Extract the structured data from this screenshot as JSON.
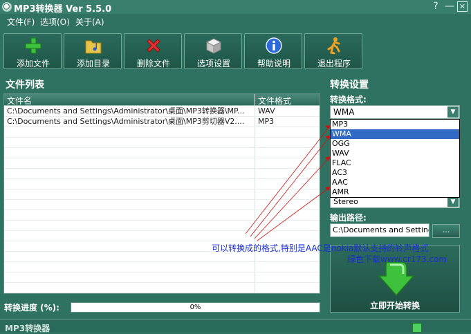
{
  "window": {
    "title": "MP3转换器 Ver 5.5.0",
    "help_glyph": "?",
    "minimize_glyph": "—",
    "close_glyph": "✕"
  },
  "menu": [
    "文件(F)",
    "选项(O)",
    "关于(A)"
  ],
  "toolbar": [
    {
      "label": "添加文件",
      "icon": "add-plus-icon"
    },
    {
      "label": "添加目录",
      "icon": "folder-music-icon"
    },
    {
      "label": "删除文件",
      "icon": "delete-x-icon"
    },
    {
      "label": "选项设置",
      "icon": "options-cube-icon"
    },
    {
      "label": "帮助说明",
      "icon": "info-icon"
    },
    {
      "label": "退出程序",
      "icon": "exit-runner-icon"
    }
  ],
  "file_list": {
    "title": "文件列表",
    "columns": [
      "文件名",
      "文件格式"
    ],
    "rows": [
      {
        "name": "C:\\Documents and Settings\\Administrator\\桌面\\MP3转换器\\MP...",
        "format": "WAV"
      },
      {
        "name": "C:\\Documents and Settings\\Administrator\\桌面\\MP3剪切器V2....",
        "format": "MP3"
      }
    ]
  },
  "progress": {
    "label": "转换进度 (%):",
    "value_text": "0%",
    "value": 0
  },
  "settings": {
    "title": "转换设置",
    "format_label": "转换格式:",
    "selected_format": "WMA",
    "format_options": [
      "MP3",
      "WMA",
      "OGG",
      "WAV",
      "FLAC",
      "AC3",
      "AAC",
      "AMR"
    ],
    "channel_value": "Stereo",
    "output_label": "输出路径:",
    "output_path": "C:\\Documents and Settings",
    "browse_label": "...",
    "start_label": "立即开始转换"
  },
  "annotation": {
    "line1": "可以转换成的格式,特别是AAC是nokia默认支持的铃声格式",
    "line2": "绿色下载www.cr173.com"
  },
  "status": {
    "text": "MP3转换器"
  },
  "colors": {
    "background": "#2f7262",
    "annotation": "#1a2fd0",
    "arrow": "#d01010",
    "selection": "#316ac5"
  }
}
